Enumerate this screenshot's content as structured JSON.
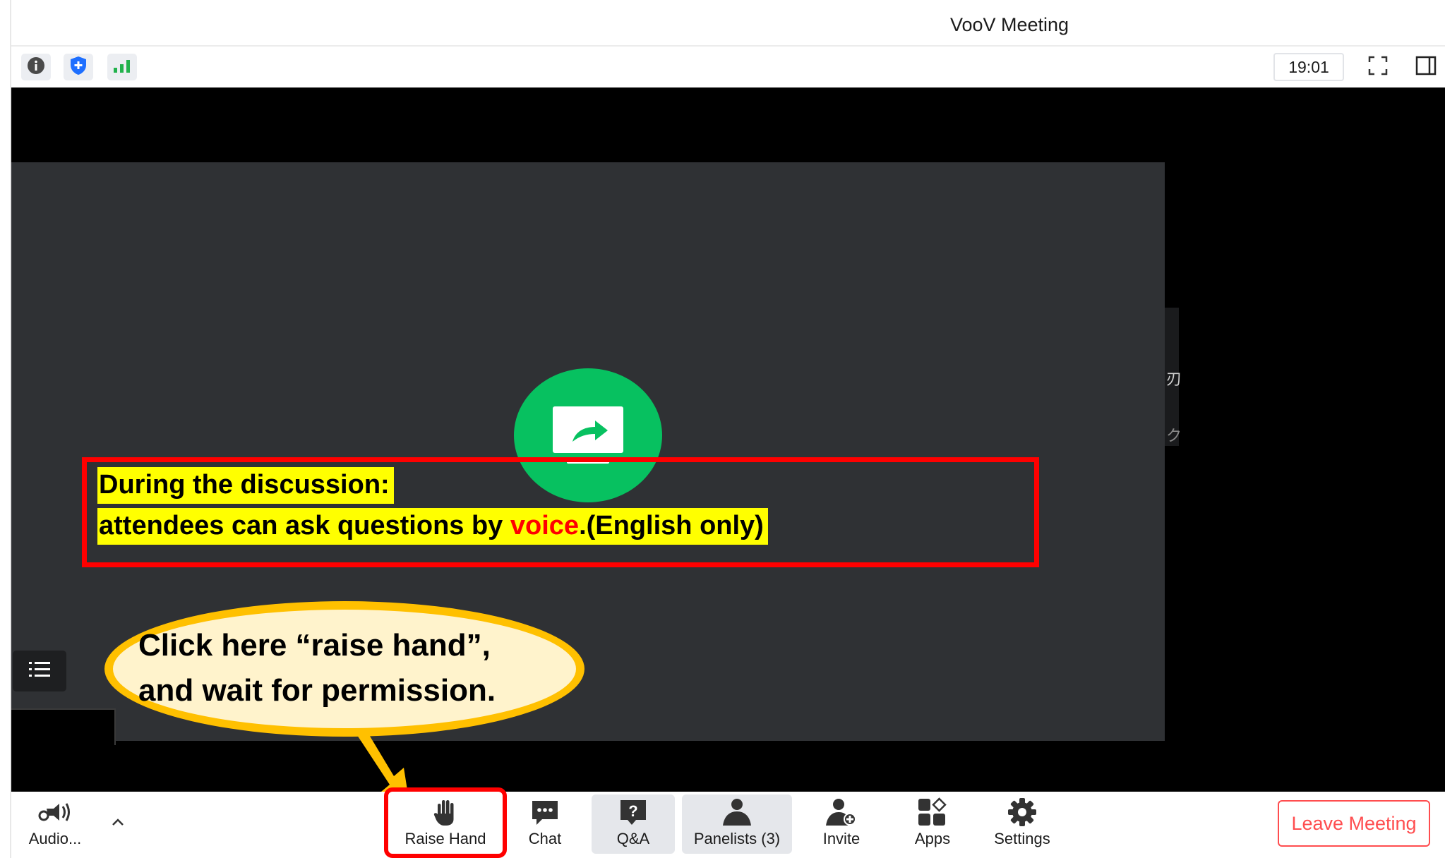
{
  "window": {
    "title": "VooV Meeting"
  },
  "infobar": {
    "icons": [
      "info-icon",
      "shield-icon",
      "signal-icon"
    ],
    "timer": "19:01",
    "right_icons": [
      "fullscreen-icon",
      "side-panel-icon"
    ]
  },
  "meeting": {
    "share_icon": "screen-share-icon",
    "side_glyphs": [
      "刃",
      "ク"
    ],
    "notice": {
      "line1": "During the discussion:",
      "line2_before": "attendees can ask questions by ",
      "line2_highlight": "voice",
      "line2_after": ".(English only)"
    },
    "callout": {
      "line1": "Click here “raise hand”,",
      "line2": "and wait for permission."
    }
  },
  "toolbar": {
    "audio_label": "Audio...",
    "raise_hand_label": "Raise Hand",
    "chat_label": "Chat",
    "qa_label": "Q&A",
    "panelists_label": "Panelists (3)",
    "invite_label": "Invite",
    "apps_label": "Apps",
    "settings_label": "Settings",
    "leave_label": "Leave Meeting"
  },
  "colors": {
    "accent_green": "#07c160",
    "annotation_red": "#ff0000",
    "highlight_yellow": "#ffff00",
    "callout_border": "#ffc000",
    "callout_fill": "#fff3cc",
    "leave_red": "#ff4d4f",
    "signal_green": "#22b24c",
    "shield_blue": "#1e6fff"
  }
}
